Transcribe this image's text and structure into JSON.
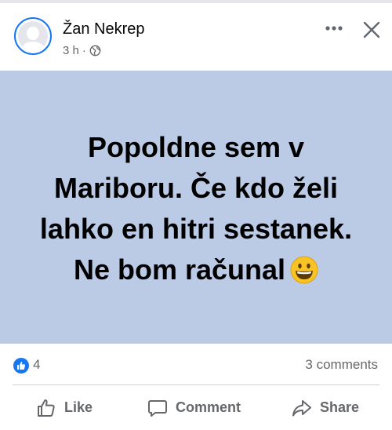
{
  "post": {
    "author": "Žan Nekrep",
    "time": "3 h",
    "separator": "·",
    "audience_icon": "globe-icon",
    "text": "Popoldne sem v Mariboru. Če kdo želi lahko en hitri sestanek. Ne bom računal",
    "emoji": "grinning-face-icon",
    "background_color": "#bccbe5"
  },
  "reactions": {
    "icon": "like-reaction-icon",
    "count": "4",
    "comments": "3 comments"
  },
  "actions": {
    "like": "Like",
    "comment": "Comment",
    "share": "Share"
  },
  "colors": {
    "accent": "#1877f2",
    "secondary_text": "#65676b"
  }
}
